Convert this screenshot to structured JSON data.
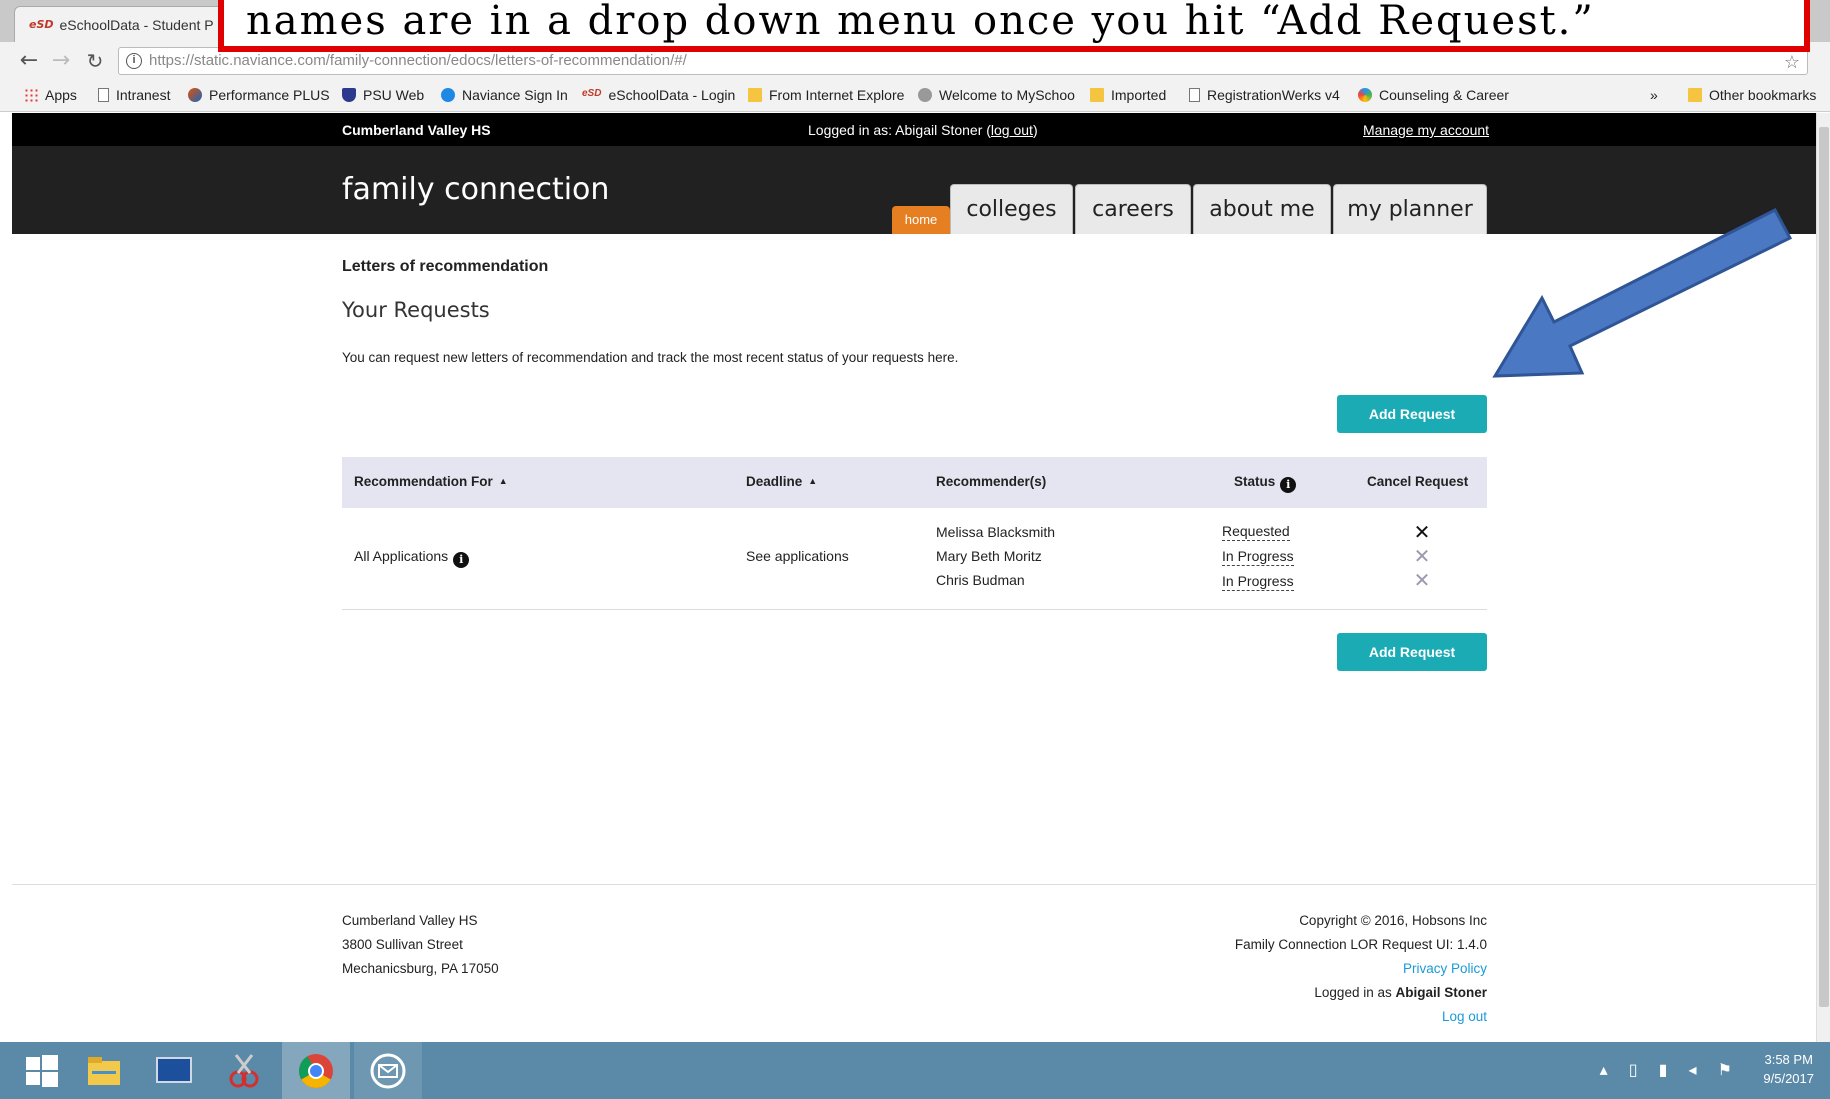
{
  "browser": {
    "tab_title": "eSchoolData - Student P",
    "tab_icon": "eSD",
    "url": "https://static.naviance.com/family-connection/edocs/letters-of-recommendation/#/",
    "bookmarks": [
      {
        "label": "Apps",
        "icon": "apps-grid-icon"
      },
      {
        "label": "Intranest",
        "icon": "page-icon"
      },
      {
        "label": "Performance PLUS",
        "icon": "globe-icon"
      },
      {
        "label": "PSU Web",
        "icon": "shield-icon"
      },
      {
        "label": "Naviance Sign In",
        "icon": "naviance-icon"
      },
      {
        "label": "eSchoolData - Login",
        "icon": "esd-icon"
      },
      {
        "label": "From Internet Explore",
        "icon": "folder-icon"
      },
      {
        "label": "Welcome to MySchoo",
        "icon": "gear-icon"
      },
      {
        "label": "Imported",
        "icon": "folder-icon"
      },
      {
        "label": "RegistrationWerks v4",
        "icon": "page-icon"
      },
      {
        "label": "Counseling & Career",
        "icon": "swirl-icon"
      }
    ],
    "overflow": "»",
    "other_bookmarks": "Other bookmarks",
    "esd_label": "eSD"
  },
  "header": {
    "school": "Cumberland Valley HS",
    "logged_prefix": "Logged in as: Abigail Stoner (",
    "logout_link": "log out",
    "logged_suffix": ")",
    "manage_account": "Manage my account",
    "brand": "family connection",
    "home_tab": "home",
    "tabs": [
      "colleges",
      "careers",
      "about me",
      "my planner"
    ]
  },
  "main": {
    "breadcrumb": "Letters of recommendation",
    "section_title": "Your Requests",
    "intro": "You can request new letters of recommendation and track the most recent status of your requests here.",
    "add_request": "Add Request",
    "table": {
      "headers": [
        "Recommendation For",
        "Deadline",
        "Recommender(s)",
        "Status",
        "Cancel Request"
      ],
      "sort_arrow": "▲",
      "row": {
        "for": "All Applications",
        "deadline": "See applications",
        "recommenders": [
          {
            "name": "Melissa Blacksmith",
            "status": "Requested",
            "cancel": "✕",
            "cancel_color": "#111111"
          },
          {
            "name": "Mary Beth Moritz",
            "status": "In Progress",
            "cancel": "✕",
            "cancel_color": "#9a9ab0"
          },
          {
            "name": "Chris Budman",
            "status": "In Progress",
            "cancel": "✕",
            "cancel_color": "#9a9ab0"
          }
        ]
      }
    }
  },
  "footer": {
    "address": [
      "Cumberland Valley HS",
      "3800 Sullivan Street",
      "Mechanicsburg, PA 17050"
    ],
    "copyright": "Copyright © 2016, Hobsons Inc",
    "version": "Family Connection LOR Request UI: 1.4.0",
    "privacy": "Privacy Policy",
    "logged_prefix": "Logged in as ",
    "logged_user": "Abigail Stoner",
    "logout": "Log out"
  },
  "taskbar": {
    "time": "3:58 PM",
    "date": "9/5/2017"
  },
  "annotation": {
    "callout_text": "names are in a drop down menu once you hit “Add Request.”",
    "arrow_color": "#4a78c2"
  },
  "colors": {
    "accent_teal": "#1aabb4",
    "home_orange": "#e67e22",
    "callout_red": "#e10000",
    "taskbar_blue": "#5b8aa8"
  }
}
